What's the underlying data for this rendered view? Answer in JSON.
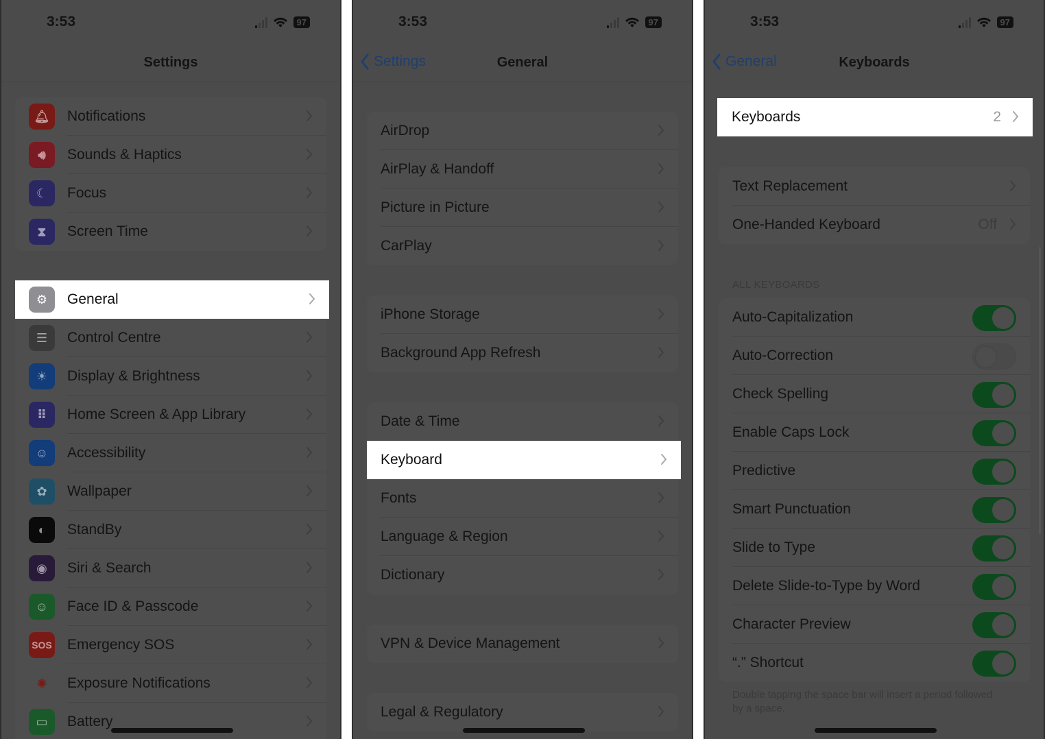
{
  "status_bar": {
    "time": "3:53",
    "battery": "97",
    "signal_bars_on": 1,
    "signal_bars_total": 4
  },
  "panel1": {
    "title": "Settings",
    "group1": [
      {
        "label": "Notifications",
        "icon": "bell-icon",
        "color": "#7a1a16"
      },
      {
        "label": "Sounds & Haptics",
        "icon": "speaker-icon",
        "color": "#7a1a22"
      },
      {
        "label": "Focus",
        "icon": "moon-icon",
        "color": "#2a2763"
      },
      {
        "label": "Screen Time",
        "icon": "hourglass-icon",
        "color": "#2a2763"
      }
    ],
    "highlighted": {
      "label": "General",
      "icon": "gear-icon",
      "color": "#8e8e93"
    },
    "group2": [
      {
        "label": "Control Centre",
        "icon": "toggles-icon",
        "color": "#3a3a3a"
      },
      {
        "label": "Display & Brightness",
        "icon": "sun-icon",
        "color": "#123c7a"
      },
      {
        "label": "Home Screen & App Library",
        "icon": "grid-icon",
        "color": "#2a2763"
      },
      {
        "label": "Accessibility",
        "icon": "accessibility-icon",
        "color": "#123c7a"
      },
      {
        "label": "Wallpaper",
        "icon": "flower-icon",
        "color": "#1f4f66"
      },
      {
        "label": "StandBy",
        "icon": "standby-icon",
        "color": "#0a0a0a"
      },
      {
        "label": "Siri & Search",
        "icon": "siri-icon",
        "color": "#2a1a3a"
      },
      {
        "label": "Face ID & Passcode",
        "icon": "faceid-icon",
        "color": "#1a5a2a"
      },
      {
        "label": "Emergency SOS",
        "icon": "sos-icon",
        "color": "#7a1a16",
        "glyph": "SOS"
      },
      {
        "label": "Exposure Notifications",
        "icon": "exposure-icon",
        "color": "#4e4e4e"
      },
      {
        "label": "Battery",
        "icon": "battery-icon",
        "color": "#1a5a2a"
      }
    ]
  },
  "panel2": {
    "back_label": "Settings",
    "title": "General",
    "group1": [
      "AirDrop",
      "AirPlay & Handoff",
      "Picture in Picture",
      "CarPlay"
    ],
    "group2": [
      "iPhone Storage",
      "Background App Refresh"
    ],
    "group3_before": [
      "Date & Time"
    ],
    "highlighted": "Keyboard",
    "group3_after": [
      "Fonts",
      "Language & Region",
      "Dictionary"
    ],
    "group4": [
      "VPN & Device Management"
    ],
    "group5": [
      "Legal & Regulatory"
    ]
  },
  "panel3": {
    "back_label": "General",
    "title": "Keyboards",
    "highlighted": {
      "label": "Keyboards",
      "value": "2"
    },
    "group1": [
      {
        "label": "Text Replacement",
        "value": ""
      },
      {
        "label": "One-Handed Keyboard",
        "value": "Off"
      }
    ],
    "section_header": "ALL KEYBOARDS",
    "toggles": [
      {
        "label": "Auto-Capitalization",
        "on": true
      },
      {
        "label": "Auto-Correction",
        "on": false
      },
      {
        "label": "Check Spelling",
        "on": true
      },
      {
        "label": "Enable Caps Lock",
        "on": true
      },
      {
        "label": "Predictive",
        "on": true
      },
      {
        "label": "Smart Punctuation",
        "on": true
      },
      {
        "label": "Slide to Type",
        "on": true
      },
      {
        "label": "Delete Slide-to-Type by Word",
        "on": true
      },
      {
        "label": "Character Preview",
        "on": true
      },
      {
        "label": "“.” Shortcut",
        "on": true
      }
    ],
    "footer": "Double tapping the space bar will insert a period followed by a space."
  },
  "colors": {
    "highlight": "#ffffff",
    "dim_bg": "#4b4b4b",
    "toggle_on": "#0c4a1d",
    "link": "#1f3f6e"
  }
}
